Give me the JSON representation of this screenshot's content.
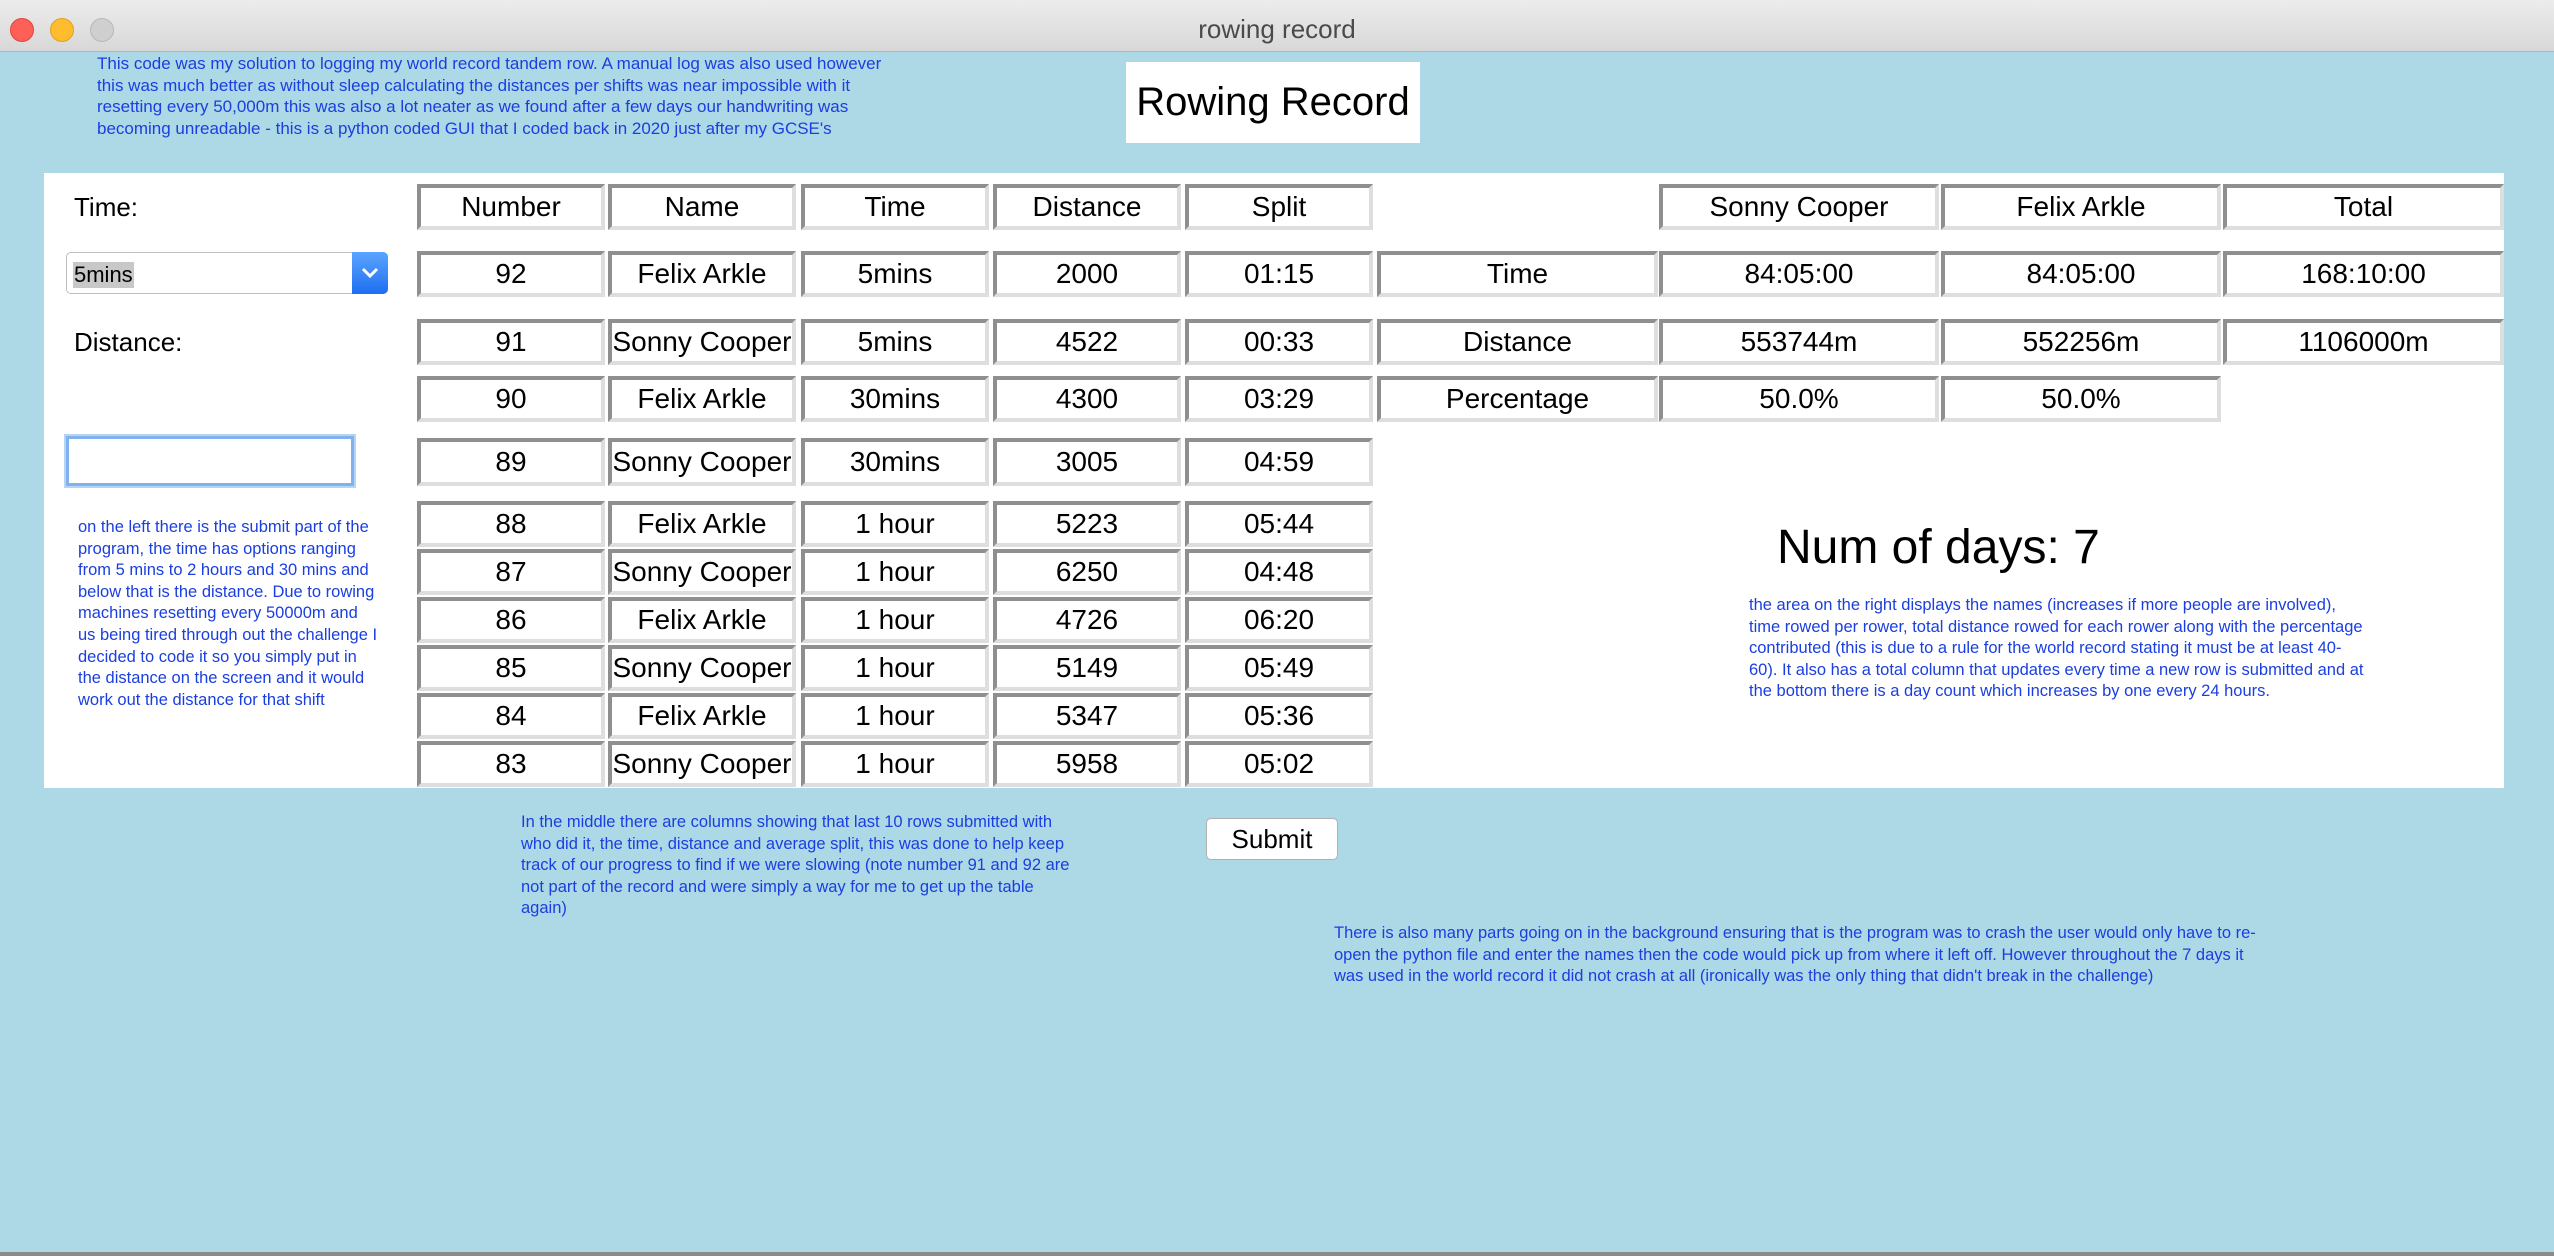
{
  "window": {
    "title": "rowing record"
  },
  "app_title": "Rowing Record",
  "notes": {
    "intro": "This code was my solution to logging my world record tandem row. A manual log was also used however this was much better as without sleep calculating the distances per shifts was near impossible with it resetting every 50,000m this was also a lot neater as we found after a few days our handwriting was becoming unreadable - this is a python coded GUI that I coded back in 2020 just after my GCSE's",
    "left": "on the left there is the submit part of the program, the time has options ranging from 5 mins to 2 hours and 30 mins and below that is the distance. Due to rowing machines resetting every 50000m and us being tired through out the challenge I decided to code it so you simply put in the distance on the screen and it would work out the distance for that shift",
    "middle": "In the middle there are columns showing that last 10 rows submitted with who did it, the time, distance and average split, this was done to help keep track of our progress to find if we were slowing (note number 91 and 92 are not part of the record and were simply a way for me to get up the table again)",
    "right": "the area on the right displays the names (increases if more people are involved), time rowed per rower, total distance rowed for each rower along with the percentage contributed (this is due to a rule for the world record stating it must be at least 40-60). It also has a total column that updates every time a new row is submitted and at the bottom there is a day count which increases by one every 24 hours.",
    "bottom": "There is also many parts going on in the background ensuring that is the program was to crash the user would only have to re-open the python file and enter the names then the code would pick up from where it left off. However throughout the 7 days it was used in the world record it did not crash at all (ironically was the only thing that didn't break in the challenge)"
  },
  "form": {
    "time_label": "Time:",
    "time_value": "5mins",
    "distance_label": "Distance:",
    "distance_value": "",
    "submit_label": "Submit"
  },
  "log": {
    "headers": [
      "Number",
      "Name",
      "Time",
      "Distance",
      "Split"
    ],
    "rows": [
      [
        "92",
        "Felix Arkle",
        "5mins",
        "2000",
        "01:15"
      ],
      [
        "91",
        "Sonny Cooper",
        "5mins",
        "4522",
        "00:33"
      ],
      [
        "90",
        "Felix Arkle",
        "30mins",
        "4300",
        "03:29"
      ],
      [
        "89",
        "Sonny Cooper",
        "30mins",
        "3005",
        "04:59"
      ],
      [
        "88",
        "Felix Arkle",
        "1 hour",
        "5223",
        "05:44"
      ],
      [
        "87",
        "Sonny Cooper",
        "1 hour",
        "6250",
        "04:48"
      ],
      [
        "86",
        "Felix Arkle",
        "1 hour",
        "4726",
        "06:20"
      ],
      [
        "85",
        "Sonny Cooper",
        "1 hour",
        "5149",
        "05:49"
      ],
      [
        "84",
        "Felix Arkle",
        "1 hour",
        "5347",
        "05:36"
      ],
      [
        "83",
        "Sonny Cooper",
        "1 hour",
        "5958",
        "05:02"
      ]
    ]
  },
  "summary": {
    "headers": [
      "Sonny Cooper",
      "Felix Arkle",
      "Total"
    ],
    "rows": [
      {
        "label": "Time",
        "values": [
          "84:05:00",
          "84:05:00",
          "168:10:00"
        ]
      },
      {
        "label": "Distance",
        "values": [
          "553744m",
          "552256m",
          "1106000m"
        ]
      },
      {
        "label": "Percentage",
        "values": [
          "50.0%",
          "50.0%"
        ]
      }
    ],
    "days_text": "Num of days: 7"
  }
}
